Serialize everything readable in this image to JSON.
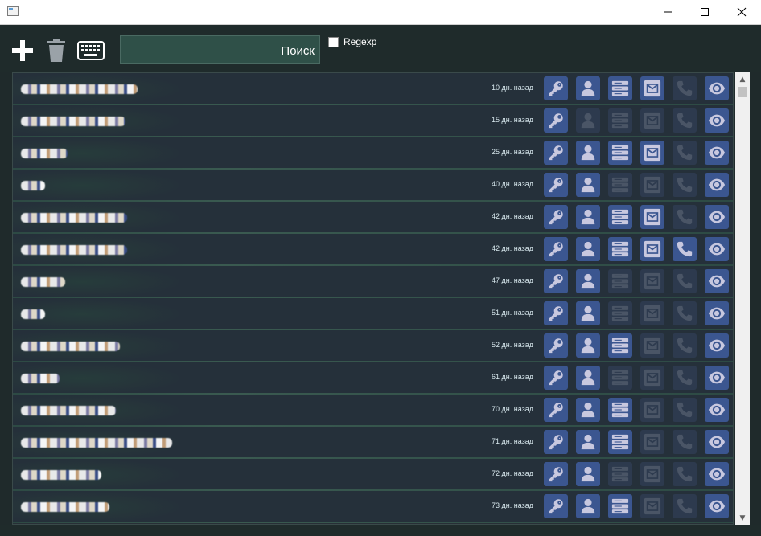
{
  "window": {
    "title": "",
    "controls": {
      "minimize_icon": "minimize-icon",
      "maximize_icon": "maximize-icon",
      "close_icon": "close-icon"
    }
  },
  "toolbar": {
    "add_icon": "plus-icon",
    "delete_icon": "trash-icon",
    "keyboard_icon": "keyboard-icon",
    "search": {
      "value": "",
      "placeholder": "Поиск"
    },
    "regexp": {
      "label": "Regexp",
      "checked": false
    }
  },
  "colors": {
    "background": "#1f2a2b",
    "row": "#25303a",
    "action_on": "#3b5690",
    "action_off": "#2d3a4e",
    "icon_on": "#c8c8df",
    "icon_off": "#4a5566"
  },
  "rows": [
    {
      "age": "10 дн. назад",
      "key": true,
      "user": true,
      "server": true,
      "mail": true,
      "phone": false,
      "view": true
    },
    {
      "age": "15 дн. назад",
      "key": true,
      "user": false,
      "server": false,
      "mail": false,
      "phone": false,
      "view": true
    },
    {
      "age": "25 дн. назад",
      "key": true,
      "user": true,
      "server": true,
      "mail": true,
      "phone": false,
      "view": true
    },
    {
      "age": "40 дн. назад",
      "key": true,
      "user": true,
      "server": false,
      "mail": false,
      "phone": false,
      "view": true
    },
    {
      "age": "42 дн. назад",
      "key": true,
      "user": true,
      "server": true,
      "mail": true,
      "phone": false,
      "view": true
    },
    {
      "age": "42 дн. назад",
      "key": true,
      "user": true,
      "server": true,
      "mail": true,
      "phone": true,
      "view": true
    },
    {
      "age": "47 дн. назад",
      "key": true,
      "user": true,
      "server": false,
      "mail": false,
      "phone": false,
      "view": true
    },
    {
      "age": "51 дн. назад",
      "key": true,
      "user": true,
      "server": false,
      "mail": false,
      "phone": false,
      "view": true
    },
    {
      "age": "52 дн. назад",
      "key": true,
      "user": true,
      "server": true,
      "mail": false,
      "phone": false,
      "view": true
    },
    {
      "age": "61 дн. назад",
      "key": true,
      "user": true,
      "server": false,
      "mail": false,
      "phone": false,
      "view": true
    },
    {
      "age": "70 дн. назад",
      "key": true,
      "user": true,
      "server": true,
      "mail": false,
      "phone": false,
      "view": true
    },
    {
      "age": "71 дн. назад",
      "key": true,
      "user": true,
      "server": true,
      "mail": false,
      "phone": false,
      "view": true
    },
    {
      "age": "72 дн. назад",
      "key": true,
      "user": true,
      "server": false,
      "mail": false,
      "phone": false,
      "view": true
    },
    {
      "age": "73 дн. назад",
      "key": true,
      "user": true,
      "server": true,
      "mail": false,
      "phone": false,
      "view": true
    }
  ],
  "action_icons": [
    "key-icon",
    "user-icon",
    "server-icon",
    "mail-icon",
    "phone-icon",
    "eye-icon"
  ]
}
